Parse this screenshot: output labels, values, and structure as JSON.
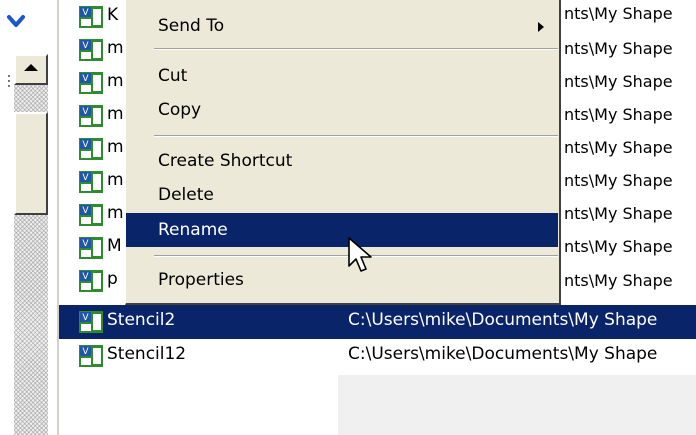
{
  "menu": {
    "items": [
      {
        "label": "Send To"
      },
      {
        "label": "Cut"
      },
      {
        "label": "Copy"
      },
      {
        "label": "Create Shortcut"
      },
      {
        "label": "Delete"
      },
      {
        "label": "Rename"
      },
      {
        "label": "Properties"
      }
    ],
    "highlighted": "Rename"
  },
  "files": {
    "partial_names": [
      "K",
      "m",
      "m",
      "m",
      "m",
      "m",
      "m",
      "M",
      "p"
    ],
    "partial_path": "nts\\My Shape",
    "rows": [
      {
        "name": "Stencil2",
        "path": "C:\\Users\\mike\\Documents\\My Shape",
        "selected": true
      },
      {
        "name": "Stencil12",
        "path": "C:\\Users\\mike\\Documents\\My Shape",
        "selected": false
      }
    ]
  },
  "colors": {
    "selection": "#0a246a",
    "menu_background": "#ece9d8",
    "icon_green": "#2e8b2e",
    "icon_blue": "#1f57a8"
  }
}
